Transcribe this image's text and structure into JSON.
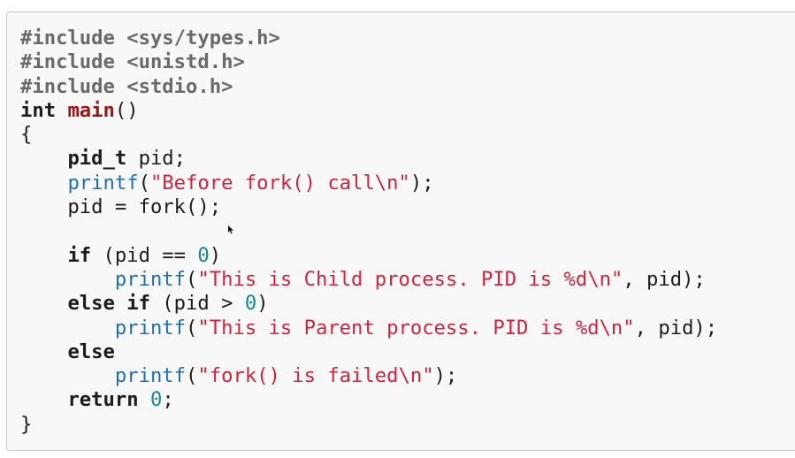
{
  "code_block": {
    "lines": [
      [
        {
          "t": "#include <sys/types.h>",
          "c": "pre"
        }
      ],
      [
        {
          "t": "#include <unistd.h>",
          "c": "pre"
        }
      ],
      [
        {
          "t": "#include <stdio.h>",
          "c": "pre"
        }
      ],
      [
        {
          "t": "int",
          "c": "ty"
        },
        {
          "t": " "
        },
        {
          "t": "main",
          "c": "fn"
        },
        {
          "t": "()"
        }
      ],
      [
        {
          "t": "{"
        }
      ],
      [
        {
          "t": "    "
        },
        {
          "t": "pid_t",
          "c": "ty"
        },
        {
          "t": " pid;"
        }
      ],
      [
        {
          "t": "    "
        },
        {
          "t": "printf",
          "c": "call"
        },
        {
          "t": "("
        },
        {
          "t": "\"Before fork() call\\n\"",
          "c": "str"
        },
        {
          "t": ");"
        }
      ],
      [
        {
          "t": "    pid = fork();"
        }
      ],
      [
        {
          "t": ""
        }
      ],
      [
        {
          "t": "    "
        },
        {
          "t": "if",
          "c": "kw"
        },
        {
          "t": " (pid == "
        },
        {
          "t": "0",
          "c": "num"
        },
        {
          "t": ")"
        }
      ],
      [
        {
          "t": "        "
        },
        {
          "t": "printf",
          "c": "call"
        },
        {
          "t": "("
        },
        {
          "t": "\"This is Child process. PID is %d\\n\"",
          "c": "str"
        },
        {
          "t": ", pid);"
        }
      ],
      [
        {
          "t": "    "
        },
        {
          "t": "else",
          "c": "kw"
        },
        {
          "t": " "
        },
        {
          "t": "if",
          "c": "kw"
        },
        {
          "t": " (pid > "
        },
        {
          "t": "0",
          "c": "num"
        },
        {
          "t": ")"
        }
      ],
      [
        {
          "t": "        "
        },
        {
          "t": "printf",
          "c": "call"
        },
        {
          "t": "("
        },
        {
          "t": "\"This is Parent process. PID is %d\\n\"",
          "c": "str"
        },
        {
          "t": ", pid);"
        }
      ],
      [
        {
          "t": "    "
        },
        {
          "t": "else",
          "c": "kw"
        }
      ],
      [
        {
          "t": "        "
        },
        {
          "t": "printf",
          "c": "call"
        },
        {
          "t": "("
        },
        {
          "t": "\"fork() is failed\\n\"",
          "c": "str"
        },
        {
          "t": ");"
        }
      ],
      [
        {
          "t": "    "
        },
        {
          "t": "return",
          "c": "kw"
        },
        {
          "t": " "
        },
        {
          "t": "0",
          "c": "num"
        },
        {
          "t": ";"
        }
      ],
      [
        {
          "t": "}"
        }
      ]
    ]
  },
  "colors": {
    "background": "#f8f8f8",
    "border": "#c8c8c8",
    "preprocessor": "#6a6a6a",
    "keyword": "#1c1c1c",
    "function_name": "#a31515",
    "function_call": "#1f6fb5",
    "string": "#d1243f",
    "number": "#148a8a"
  },
  "icons": {
    "cursor": "mouse-pointer-icon"
  }
}
